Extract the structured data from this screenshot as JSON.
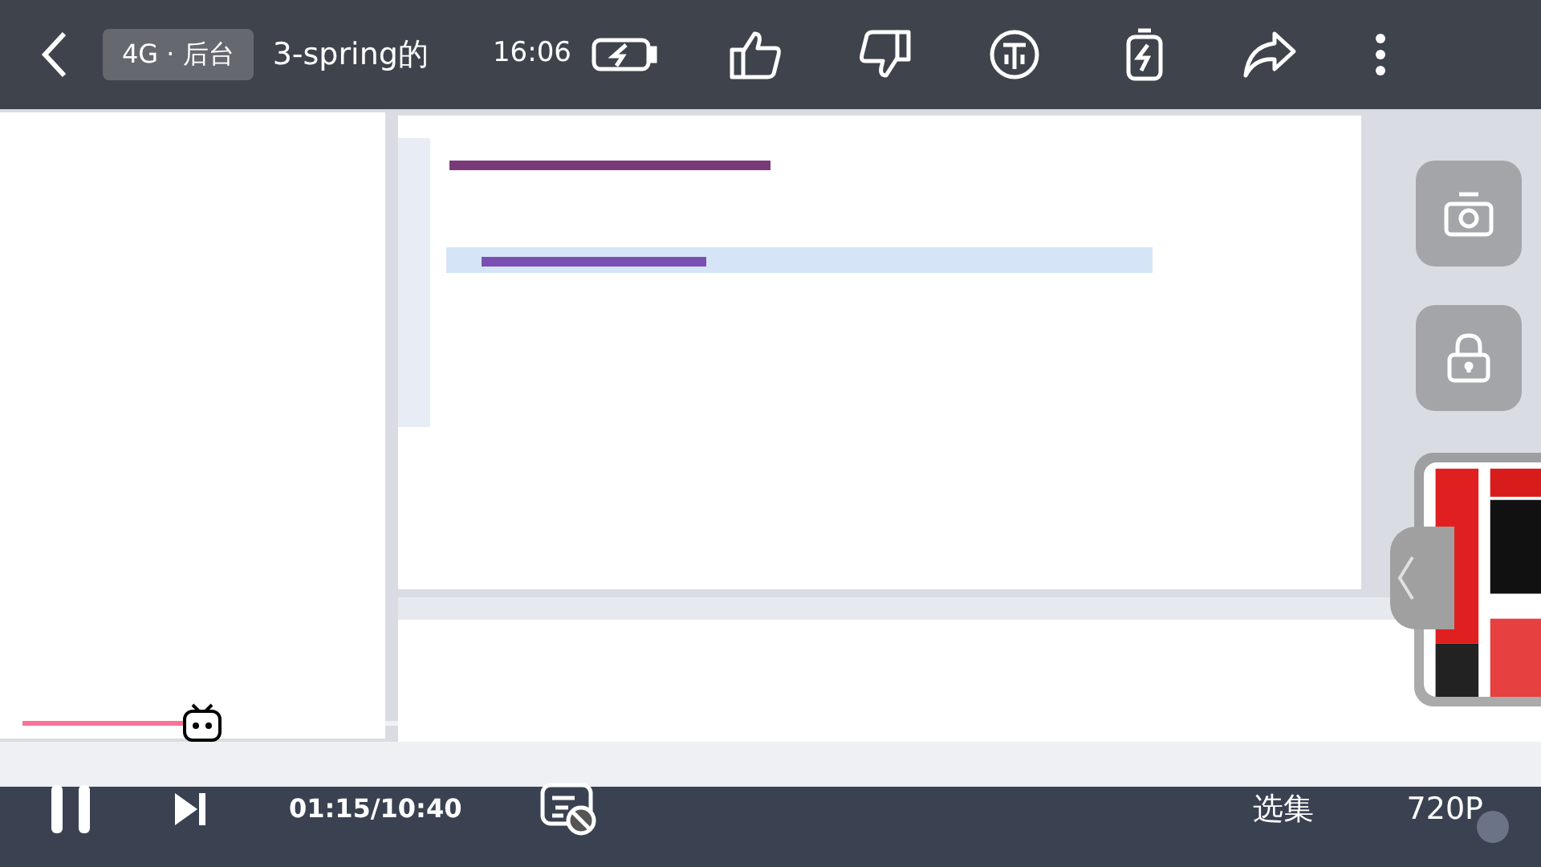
{
  "video": {
    "kind": "picture",
    "playing": true
  },
  "top_bar": {
    "network": "4G · 后台",
    "title": "3-spring的",
    "clock": "16:06"
  },
  "ad": {
    "kind": "picture"
  },
  "progress": {
    "level": 0.12
  },
  "bottom_bar": {
    "time": "01:15/10:40",
    "episodes": "选集",
    "quality": "720P"
  }
}
